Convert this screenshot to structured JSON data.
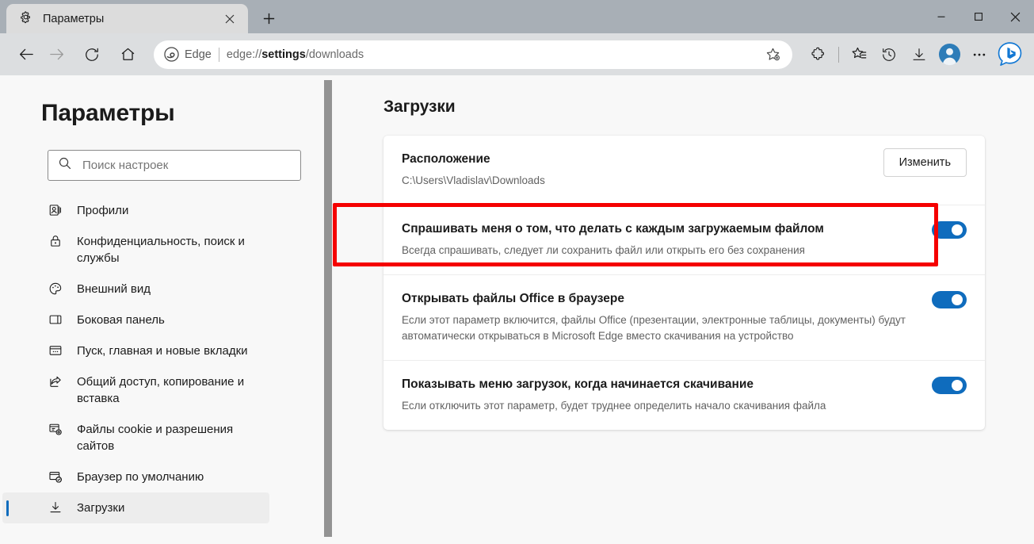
{
  "window": {
    "minimize_label": "Свернуть",
    "maximize_label": "Развернуть",
    "close_label": "Закрыть"
  },
  "tab": {
    "title": "Параметры",
    "close_label": "Закрыть вкладку",
    "new_tab_label": "Новая вкладка"
  },
  "toolbar": {
    "back_label": "Назад",
    "forward_label": "Вперед",
    "refresh_label": "Обновить",
    "home_label": "Главная",
    "edge_label": "Edge",
    "url_prefix": "edge://",
    "url_domain": "settings",
    "url_path": "/downloads",
    "favorite_label": "Добавить в избранное",
    "extensions_label": "Расширения",
    "collections_label": "Коллекции",
    "history_label": "Журнал",
    "downloads_label": "Загрузки",
    "profile_label": "Профиль",
    "more_label": "Параметры и другое",
    "copilot_label": "Bing Chat"
  },
  "sidebar": {
    "title": "Параметры",
    "search": {
      "placeholder": "Поиск настроек",
      "value": ""
    },
    "items": [
      {
        "label": "Профили",
        "icon": "profile-icon",
        "active": false
      },
      {
        "label": "Конфиденциальность, поиск и службы",
        "icon": "lock-icon",
        "active": false
      },
      {
        "label": "Внешний вид",
        "icon": "palette-icon",
        "active": false
      },
      {
        "label": "Боковая панель",
        "icon": "sidebar-icon",
        "active": false
      },
      {
        "label": "Пуск, главная и новые вкладки",
        "icon": "start-page-icon",
        "active": false
      },
      {
        "label": "Общий доступ, копирование и вставка",
        "icon": "share-icon",
        "active": false
      },
      {
        "label": "Файлы cookie и разрешения сайтов",
        "icon": "cookie-permissions-icon",
        "active": false
      },
      {
        "label": "Браузер по умолчанию",
        "icon": "default-browser-icon",
        "active": false
      },
      {
        "label": "Загрузки",
        "icon": "download-icon",
        "active": true
      }
    ]
  },
  "main": {
    "title": "Загрузки",
    "rows": [
      {
        "title": "Расположение",
        "desc": "C:\\Users\\Vladislav\\Downloads",
        "control": "button",
        "button_label": "Изменить",
        "highlighted": false
      },
      {
        "title": "Спрашивать меня о том, что делать с каждым загружаемым файлом",
        "desc": "Всегда спрашивать, следует ли сохранить файл или открыть его без сохранения",
        "control": "toggle",
        "toggle_on": true,
        "highlighted": true
      },
      {
        "title": "Открывать файлы Office в браузере",
        "desc": "Если этот параметр включится, файлы Office (презентации, электронные таблицы, документы) будут автоматически открываться в Microsoft Edge вместо скачивания на устройство",
        "control": "toggle",
        "toggle_on": true,
        "highlighted": false
      },
      {
        "title": "Показывать меню загрузок, когда начинается скачивание",
        "desc": "Если отключить этот параметр, будет труднее определить начало скачивания файла",
        "control": "toggle",
        "toggle_on": true,
        "highlighted": false
      }
    ]
  },
  "colors": {
    "accent": "#0f6cbd",
    "annotation": "#f50000",
    "titlebar": "#a8afb6",
    "toolbar": "#dcdee0",
    "page_bg": "#f8f8f8"
  }
}
